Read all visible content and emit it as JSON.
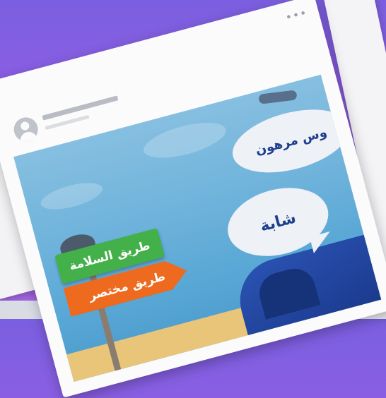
{
  "post": {
    "more_icon": "more-horizontal-icon",
    "avatar_icon": "user-avatar-icon",
    "image": {
      "sign_top": "طريق السلامة",
      "sign_bottom": "طريق مختصر",
      "bubble_top": "وس مرهون",
      "bubble_bottom": "شابة"
    }
  },
  "colors": {
    "background": "#8a5fe4",
    "sign_green": "#43b04a",
    "sign_orange": "#ee6a1f",
    "bubble_text": "#1c3f8f"
  }
}
